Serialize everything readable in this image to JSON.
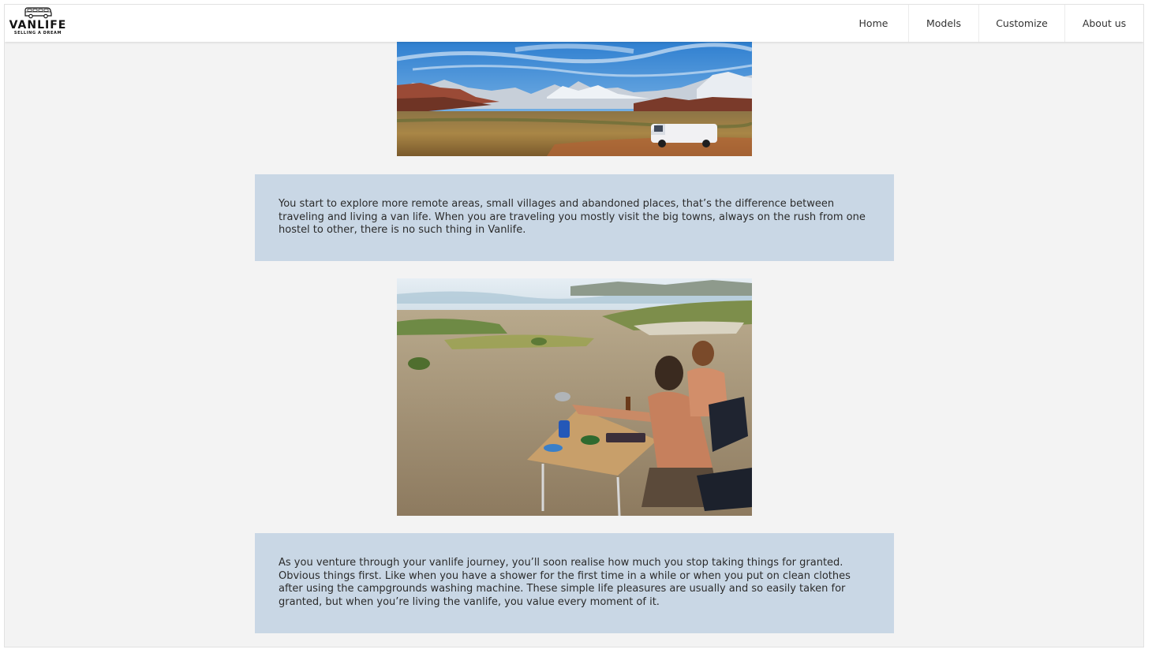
{
  "header": {
    "logo": {
      "name": "VANLIFE",
      "tagline": "SELLING A DREAM"
    },
    "nav": [
      {
        "label": "Home"
      },
      {
        "label": "Models"
      },
      {
        "label": "Customize"
      },
      {
        "label": "About us"
      }
    ]
  },
  "main": {
    "paragraphs": [
      "You start to explore more remote areas, small villages and abandoned places, that’s the difference between traveling and living a van life. When you are traveling you mostly visit the big towns, always on the rush from one hostel to other, there is no such thing in Vanlife.",
      "As you venture through your vanlife journey, you’ll soon realise how much you stop taking things for granted. Obvious things first. Like when you have a shower for the first time in a while or when you put on clean clothes after using the campgrounds washing machine. These simple life pleasures are usually and so easily taken for granted, but when you’re living the vanlife, you value every moment of it."
    ]
  },
  "colors": {
    "page_background": "#f3f3f3",
    "header_background": "#ffffff",
    "card_background": "#c9d7e5",
    "text": "#2b2b2b"
  }
}
